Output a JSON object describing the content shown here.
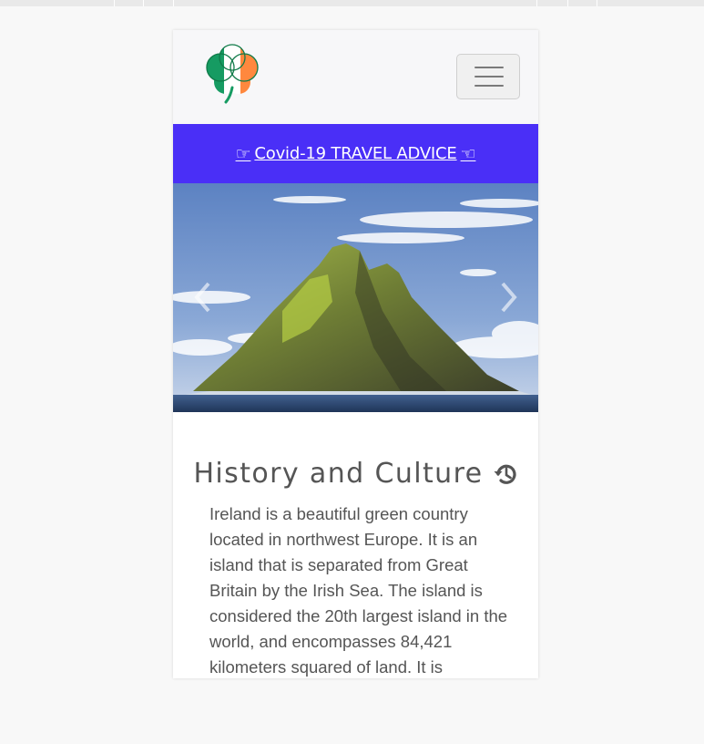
{
  "navbar": {
    "logo_alt": "Shamrock logo",
    "toggler_label": "Toggle navigation"
  },
  "banner": {
    "covid_link_text": "Covid-19 TRAVEL ADVICE",
    "accent_color": "#4a2ff7"
  },
  "carousel": {
    "image_alt": "Skellig Michael island",
    "prev_label": "Previous",
    "next_label": "Next"
  },
  "section": {
    "heading": "History and Culture",
    "icon": "history-icon",
    "paragraph": "Ireland is a beautiful green country located in northwest Europe. It is an island that is separated from Great Britain by the Irish Sea. The island is considered the 20th largest island in the world, and encompasses 84,421 kilometers squared of land. It is"
  },
  "colors": {
    "flag_green": "#169b62",
    "flag_white": "#ffffff",
    "flag_orange": "#ff883e",
    "text": "#555555"
  }
}
